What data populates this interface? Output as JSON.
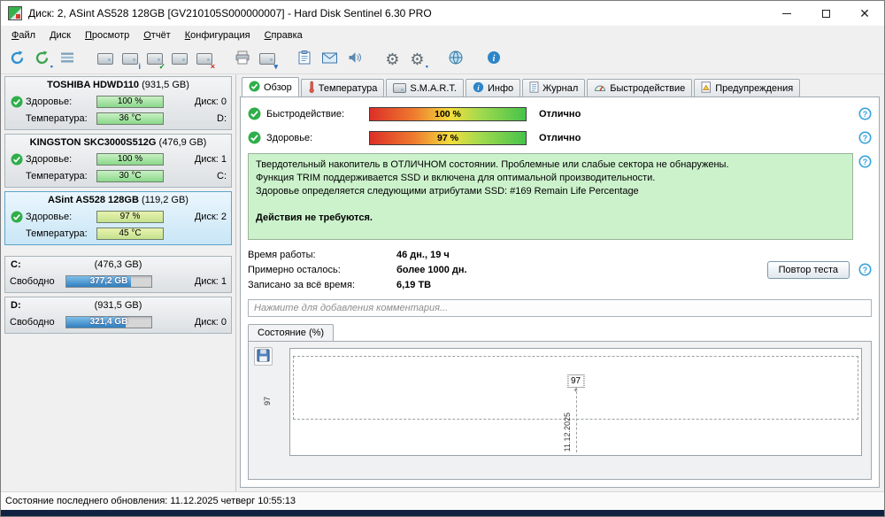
{
  "colors": {
    "selected-border": "#5da4cc",
    "info-green": "#ccf2cc",
    "usage-blue": "#2f7fc0",
    "strip": "#102240",
    "ok-green": "#2fae4a",
    "help-blue": "#35a2dc"
  },
  "titlebar": {
    "title": "Диск: 2, ASint AS528 128GB [GV210105S000000007]  -  Hard Disk Sentinel 6.30 PRO"
  },
  "menubar": {
    "items": [
      "Файл",
      "Диск",
      "Просмотр",
      "Отчёт",
      "Конфигурация",
      "Справка"
    ]
  },
  "sidebar": {
    "disks": [
      {
        "name": "TOSHIBA HDWD110",
        "capacity": "(931,5 GB)",
        "health_label": "Здоровье:",
        "health_value": "100 %",
        "disk_index": "Диск: 0",
        "temp_label": "Температура:",
        "temp_value": "36 °C",
        "drive_letter": "D:"
      },
      {
        "name": "KINGSTON SKC3000S512G",
        "capacity": "(476,9 GB)",
        "health_label": "Здоровье:",
        "health_value": "100 %",
        "disk_index": "Диск: 1",
        "temp_label": "Температура:",
        "temp_value": "30 °C",
        "drive_letter": "C:"
      },
      {
        "name": "ASint AS528 128GB",
        "capacity": "(119,2 GB)",
        "health_label": "Здоровье:",
        "health_value": "97 %",
        "disk_index": "Диск: 2",
        "temp_label": "Температура:",
        "temp_value": "45 °C",
        "drive_letter": ""
      }
    ],
    "partitions": [
      {
        "name": "C:",
        "capacity": "(476,3 GB)",
        "free_label": "Свободно",
        "free_value": "377,2 GB",
        "disk_index": "Диск: 1"
      },
      {
        "name": "D:",
        "capacity": "(931,5 GB)",
        "free_label": "Свободно",
        "free_value": "321,4 GB",
        "disk_index": "Диск: 0"
      }
    ]
  },
  "tabs": [
    {
      "label": "Обзор"
    },
    {
      "label": "Температура"
    },
    {
      "label": "S.M.A.R.T."
    },
    {
      "label": "Инфо"
    },
    {
      "label": "Журнал"
    },
    {
      "label": "Быстродействие"
    },
    {
      "label": "Предупреждения"
    }
  ],
  "overview": {
    "performance": {
      "label": "Быстродействие:",
      "value": "100 %",
      "status": "Отлично"
    },
    "health": {
      "label": "Здоровье:",
      "value": "97 %",
      "status": "Отлично"
    },
    "summary": {
      "line1": "Твердотельный накопитель в ОТЛИЧНОМ состоянии. Проблемные или слабые сектора не обнаружены.",
      "line2": "Функция TRIM поддерживается SSD и включена для оптимальной производительности.",
      "line3": "Здоровье определяется следующими атрибутами SSD: #169 Remain Life Percentage",
      "action": "Действия не требуются."
    },
    "stats": [
      {
        "label": "Время работы:",
        "value": "46 дн., 19 ч"
      },
      {
        "label": "Примерно осталось:",
        "value": "более 1000 дн."
      },
      {
        "label": "Записано за всё время:",
        "value": "6,19 TB"
      }
    ],
    "retest_button": "Повтор теста",
    "comment_placeholder": "Нажмите для добавления комментария...",
    "chart_panel": {
      "tab": "Состояние (%)",
      "axis_value": "97",
      "marker_value": "97",
      "date_label": "11.12.2025"
    }
  },
  "chart_data": {
    "type": "line",
    "title": "Состояние (%)",
    "x": [
      "11.12.2025"
    ],
    "values": [
      97
    ],
    "ylabel": "Состояние (%)",
    "ylim": [
      0,
      100
    ],
    "grid": "dashed"
  },
  "statusbar": {
    "text": "Состояние последнего обновления: 11.12.2025 четверг 10:55:13"
  }
}
